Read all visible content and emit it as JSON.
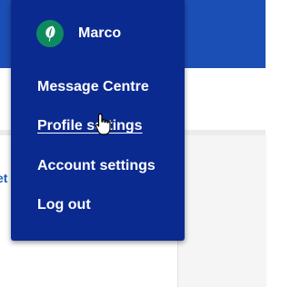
{
  "user": {
    "name": "Marco",
    "avatar_icon": "leaf-icon",
    "avatar_color": "#0e8a5f"
  },
  "menu": {
    "background": "#0b2a8f",
    "items": [
      {
        "label": "Message Centre"
      },
      {
        "label": "Profile settings",
        "state": "hovered"
      },
      {
        "label": "Account settings"
      },
      {
        "label": "Log out"
      }
    ]
  },
  "page": {
    "header_color": "#1c4fb5",
    "edge_text": "et"
  },
  "cursor": "hand-pointer-icon"
}
